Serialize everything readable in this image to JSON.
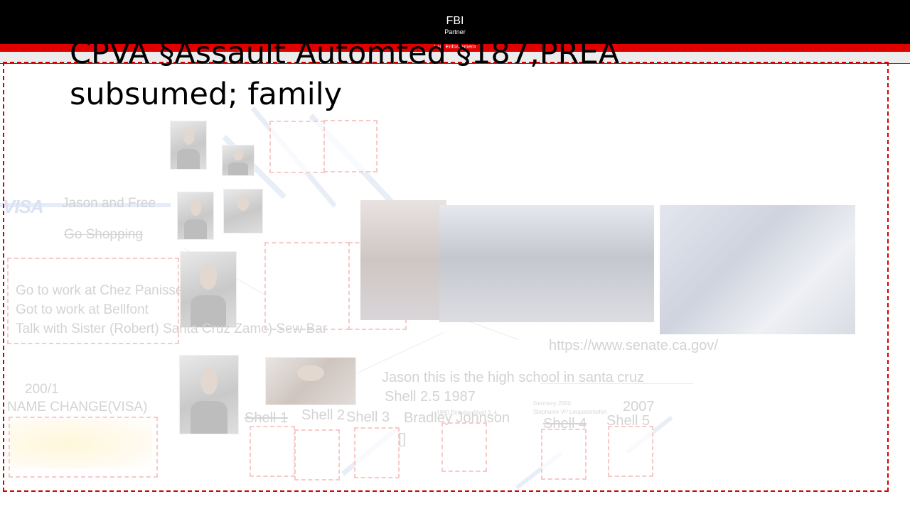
{
  "header": {
    "title": "FBI",
    "subtitle": "Partner",
    "stripe_text": "Law Enforcement"
  },
  "slide": {
    "heading": "CPVA §Assault Automted §187,PREA subsumed; family"
  },
  "visa": {
    "logo": "VISA",
    "jason_free": "Jason and Free",
    "go_shopping": "Go Shopping"
  },
  "work_notes": [
    "Go to work at Chez Panisse",
    "Got to work at Bellfont",
    "Talk with Sister (Robert) Santa Cruz Zamc) Sew Bar"
  ],
  "name_change": {
    "count": "200/1",
    "label": "NAME CHANGE(VISA)"
  },
  "links": {
    "senate_url": "https://www.senate.ca.gov/"
  },
  "school": {
    "note": "Jason this is the high school in santa cruz",
    "shell_year": "Shell 2.5 1987",
    "name": "Bradley Johnson",
    "bracket": "[]"
  },
  "small_notes": {
    "birthday": "1990 Birthday Shell 3, 4",
    "germany_line1": "Germany 2000",
    "germany_line2": "Stephanie VP Leopoldshafen"
  },
  "shells": {
    "shell1": "Shell 1",
    "shell2": "Shell 2",
    "shell3": "Shell 3",
    "shell4": "Shell 4",
    "shell5": "Shell 5",
    "year_2007": "2007"
  },
  "colors": {
    "header_bg": "#000000",
    "stripe_red": "#e00000",
    "frame_dash": "#d40000",
    "faint_text": "#d3d3d3"
  },
  "icons": {
    "visa": "visa-logo"
  }
}
